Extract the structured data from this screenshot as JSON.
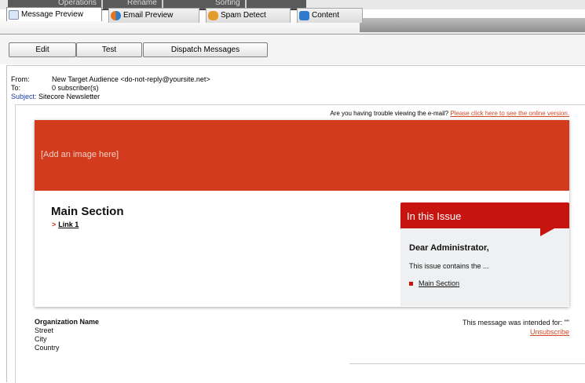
{
  "top_tabs": [
    "Operations",
    "Rename",
    "Sorting"
  ],
  "tabs": [
    {
      "label": "Message Preview",
      "icon": "preview-icon"
    },
    {
      "label": "Email Preview",
      "icon": "people-icon"
    },
    {
      "label": "Spam Detect",
      "icon": "spam-icon"
    },
    {
      "label": "Content",
      "icon": "cube-icon"
    }
  ],
  "toolbar": {
    "edit": "Edit",
    "test": "Test",
    "dispatch": "Dispatch Messages"
  },
  "header": {
    "from_label": "From:",
    "from_value": "New Target Audience <do-not-reply@yoursite.net>",
    "to_label": "To:",
    "to_value": "0 subscriber(s)",
    "subject_label": "Subject:",
    "subject_value": "Sitecore Newsletter"
  },
  "email": {
    "trouble_text": "Are you having trouble viewing the e-mail?",
    "trouble_link": "Please click here to see the online version.",
    "hero_text": "[Add an image here]",
    "main_title": "Main Section",
    "link1_arrow": ">",
    "link1": "Link 1",
    "issue_title": "In this Issue",
    "dear": "Dear Administrator,",
    "contains": "This issue contains the ...",
    "issue_link": "Main Section",
    "org_name": "Organization Name",
    "street": "Street",
    "city": "City",
    "country": "Country",
    "intended": "This message was intended for: \"\"",
    "unsubscribe": "Unsubscribe"
  },
  "colors": {
    "hero": "#d23b1e",
    "issue_head": "#c8140f",
    "link": "#d04a2a"
  }
}
